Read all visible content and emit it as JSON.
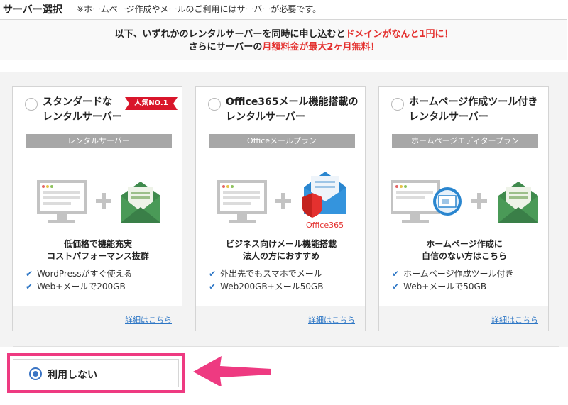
{
  "header": {
    "title": "サーバー選択",
    "note": "※ホームページ作成やメールのご利用にはサーバーが必要です。"
  },
  "promo": {
    "line1_plain": "以下、いずれかのレンタルサーバーを同時に申し込むと",
    "line1_highlight": "ドメインがなんと1円に！",
    "line2_plain1": "さらにサーバーの",
    "line2_highlight": "月額料金が最大2ヶ月無料！"
  },
  "plans": [
    {
      "title_line1": "スタンダードな",
      "title_line2": "レンタルサーバー",
      "badge": "人気NO.1",
      "category": "レンタルサーバー",
      "desc_line1": "低価格で機能充実",
      "desc_line2": "コストパフォーマンス抜群",
      "features": [
        "WordPressがすぐ使える",
        "Web+メールで200GB"
      ],
      "detail_link": "詳細はこちら"
    },
    {
      "title_line1": "Office365メール機能搭載の",
      "title_line2": "レンタルサーバー",
      "category": "Officeメールプラン",
      "logo_text": "Office365",
      "desc_line1": "ビジネス向けメール機能搭載",
      "desc_line2": "法人の方におすすめ",
      "features": [
        "外出先でもスマホでメール",
        "Web200GB+メール50GB"
      ],
      "detail_link": "詳細はこちら"
    },
    {
      "title_line1": "ホームページ作成ツール付き",
      "title_line2": "レンタルサーバー",
      "category": "ホームページエディタープラン",
      "desc_line1": "ホームページ作成に",
      "desc_line2": "自信のない方はこちら",
      "features": [
        "ホームページ作成ツール付き",
        "Web+メールで50GB"
      ],
      "detail_link": "詳細はこちら"
    }
  ],
  "no_use": {
    "label": "利用しない",
    "selected": true
  },
  "colors": {
    "accent_red": "#e4312f",
    "link_blue": "#2d76c5",
    "highlight_pink": "#ee3a81",
    "envelope_green": "#3f8a4d",
    "envelope_blue": "#2a86cf"
  }
}
